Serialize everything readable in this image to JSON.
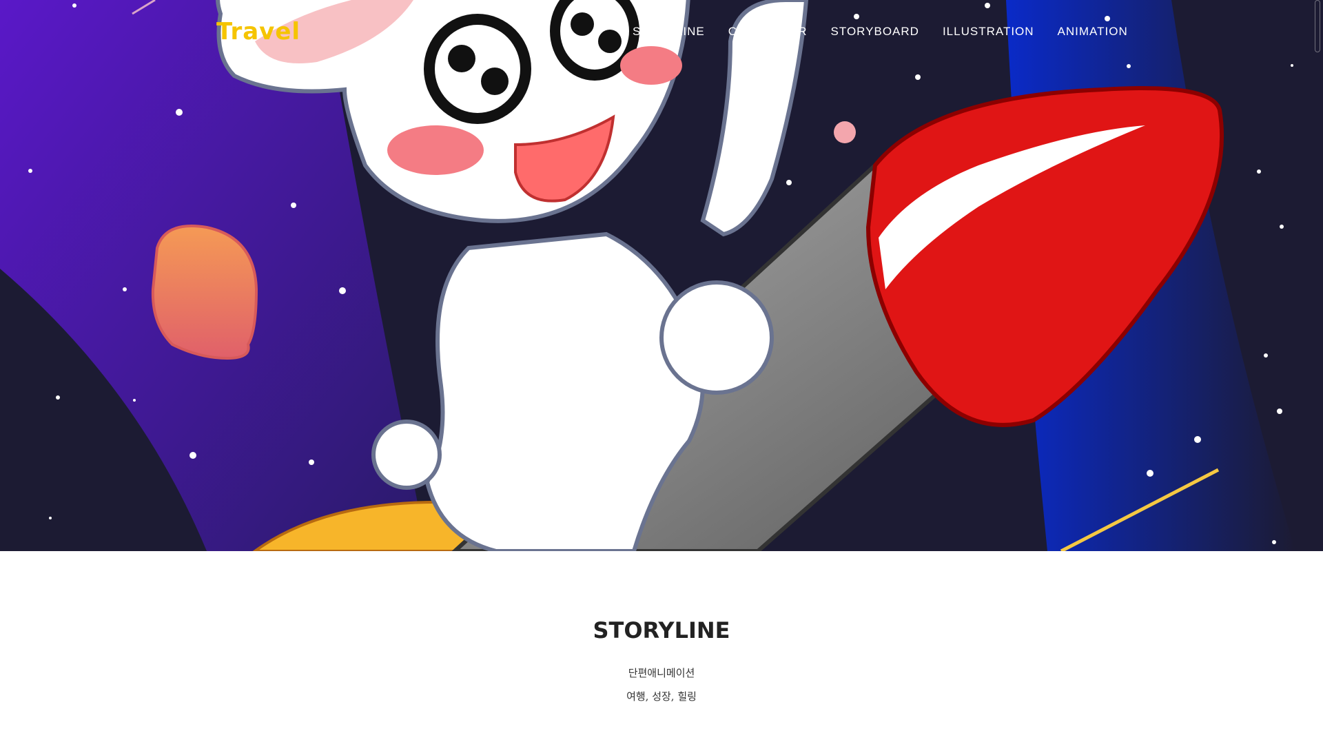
{
  "nav": {
    "logo": "Travel",
    "items": [
      "STORYLINE",
      "CHARACTER",
      "STORYBOARD",
      "ILLUSTRATION",
      "ANIMATION"
    ]
  },
  "hero": {
    "image": "bunny-riding-rocket-illustration"
  },
  "storyline": {
    "title": "STORYLINE",
    "line1": "단편애니메이션",
    "line2": "여행, 성장, 힐링"
  },
  "colors": {
    "logo": "#f5c400",
    "nav_text": "#ffffff",
    "space_dark": "#1c1b33",
    "purple": "#4a1bb0",
    "blue": "#0a2a9e",
    "rocket_red": "#e01515"
  }
}
